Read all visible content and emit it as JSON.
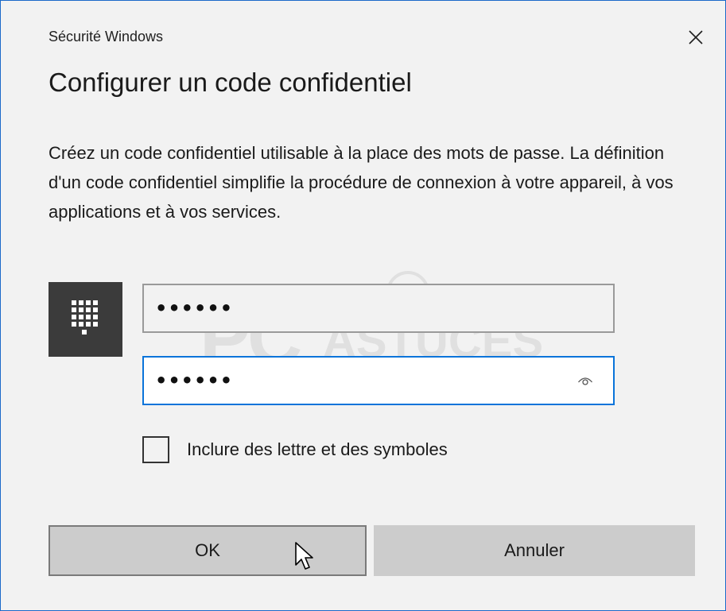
{
  "window": {
    "caption": "Sécurité Windows",
    "accent_color": "#1b6ac9"
  },
  "dialog": {
    "title": "Configurer un code confidentiel",
    "description": "Créez un code confidentiel utilisable à la place des mots de passe. La définition d'un code confidentiel simplifie la procédure de connexion à votre appareil, à vos applications et à vos services."
  },
  "watermark": {
    "brand": "PC",
    "brand_suffix": "ASTUCES"
  },
  "pin": {
    "tile_icon": "keypad-icon",
    "new_pin_value": "123456",
    "confirm_pin_value": "123456",
    "reveal_icon": "eye-icon",
    "focus_color": "#0a74da"
  },
  "options": {
    "include_letters_label": "Inclure des lettre et des symboles",
    "include_letters_checked": false
  },
  "buttons": {
    "ok_label": "OK",
    "cancel_label": "Annuler"
  }
}
